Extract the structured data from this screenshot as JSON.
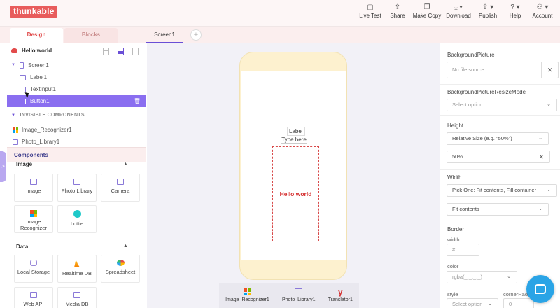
{
  "app": {
    "logo": "thunkable"
  },
  "top_actions": [
    {
      "label": "Live Test",
      "icon": "live-test-icon",
      "glyph": "▢"
    },
    {
      "label": "Share",
      "icon": "share-icon",
      "glyph": "⇪"
    },
    {
      "label": "Make Copy",
      "icon": "copy-icon",
      "glyph": "❐"
    },
    {
      "label": "Download",
      "icon": "download-icon",
      "glyph": "⤓ ▾"
    },
    {
      "label": "Publish",
      "icon": "publish-icon",
      "glyph": "⇧ ▾"
    },
    {
      "label": "Help",
      "icon": "help-icon",
      "glyph": "? ▾"
    },
    {
      "label": "Account",
      "icon": "account-icon",
      "glyph": "⚇ ▾"
    }
  ],
  "tabs": {
    "design": "Design",
    "blocks": "Blocks",
    "screen": "Screen1",
    "add": "+"
  },
  "project": {
    "name": "Hello world"
  },
  "tree": {
    "screen": "Screen1",
    "items": [
      "Label1",
      "TextInput1",
      "Button1"
    ],
    "invisible_header": "INVISIBLE COMPONENTS",
    "invisible": [
      "Image_Recognizer1",
      "Photo_Library1"
    ]
  },
  "components": {
    "header": "Components",
    "drag_glyph": ">",
    "groups": [
      {
        "title": "Image",
        "caret": "▲",
        "items": [
          "Image",
          "Photo Library",
          "Camera",
          "Image Recognizer",
          "Lottie"
        ]
      },
      {
        "title": "Data",
        "caret": "▲",
        "items": [
          "Local Storage",
          "Realtime DB",
          "Spreadsheet",
          "Web API",
          "Media DB"
        ]
      }
    ]
  },
  "canvas": {
    "label_text": "Label",
    "input_placeholder": "Type here",
    "button_text": "Hello world",
    "nonvisible": [
      "Image_Recognizer1",
      "Photo_Library1",
      "Translator1"
    ]
  },
  "properties": {
    "background_picture": {
      "label": "BackgroundPicture",
      "value": "No file source",
      "clear": "✕"
    },
    "resize_mode": {
      "label": "BackgroundPictureResizeMode",
      "value": "Select option"
    },
    "height": {
      "label": "Height",
      "mode": "Relative Size (e.g. \"50%\")",
      "value": "50%",
      "clear": "✕"
    },
    "width": {
      "label": "Width",
      "mode": "Pick One: Fit contents, Fill container",
      "value": "Fit contents"
    },
    "border": {
      "label": "Border",
      "width_label": "width",
      "width_placeholder": "#",
      "color_label": "color",
      "color_value": "rgba(_,_,_,_)",
      "style_label": "style",
      "style_value": "Select option",
      "radius_label": "cornerRadius",
      "radius_value": "0"
    }
  },
  "colors": {
    "accent": "#6a4fd6",
    "brand": "#e85c5c",
    "button_text": "#d42c2c"
  }
}
